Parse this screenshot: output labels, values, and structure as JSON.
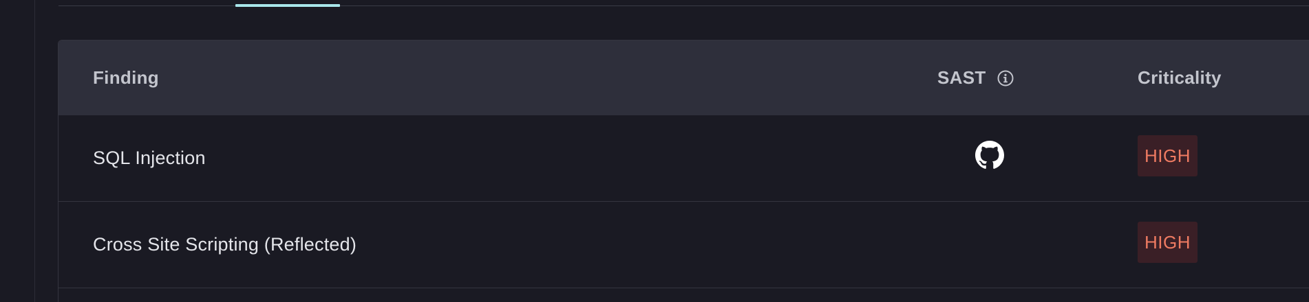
{
  "tabs": {
    "active_indicator_color": "#a8e6ea"
  },
  "table": {
    "columns": {
      "finding": "Finding",
      "sast": "SAST",
      "criticality": "Criticality"
    },
    "sast_info_icon": "info-icon",
    "rows": [
      {
        "finding": "SQL Injection",
        "sast_icon": "github-icon",
        "criticality": "HIGH"
      },
      {
        "finding": "Cross Site Scripting (Reflected)",
        "sast_icon": "",
        "criticality": "HIGH"
      }
    ]
  },
  "colors": {
    "background": "#1a1a23",
    "header_background": "#2e2f3b",
    "badge_high_background": "#3a1f26",
    "badge_high_text": "#ef7b62"
  }
}
